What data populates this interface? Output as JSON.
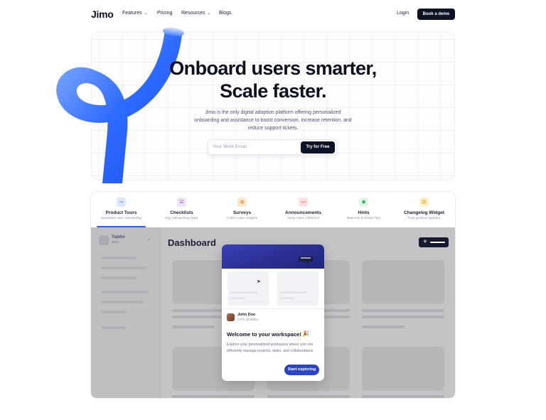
{
  "nav": {
    "logo": "Jimo",
    "links": [
      {
        "label": "Features",
        "dropdown": true
      },
      {
        "label": "Pricing",
        "dropdown": false
      },
      {
        "label": "Resources",
        "dropdown": true
      },
      {
        "label": "Blogs",
        "dropdown": false
      }
    ],
    "login": "Login",
    "cta": "Book a demo"
  },
  "hero": {
    "headline_line1": "Onboard users smarter,",
    "headline_line2": "Scale faster.",
    "subtext_line1": "Jimo is the only digital adoption platform offering personalized",
    "subtext_line2": "onboarding and assistance to boost conversion, increase retention, and",
    "subtext_line3": "reduce support tickets.",
    "email_placeholder": "Your Work Email",
    "cta": "Try for Free",
    "accent_color": "#2f6bff"
  },
  "product_tabs": [
    {
      "label": "Product Tours",
      "desc": "Seamless user onboarding",
      "icon": "route-icon",
      "icon_color": "#dce8ff",
      "active": true
    },
    {
      "label": "Checklists",
      "desc": "Key onboarding steps",
      "icon": "checklist-icon",
      "icon_color": "#f0e3ff",
      "active": false
    },
    {
      "label": "Surveys",
      "desc": "Collect user insights",
      "icon": "survey-icon",
      "icon_color": "#ffe6cf",
      "active": false
    },
    {
      "label": "Announcements",
      "desc": "Keep users informed",
      "icon": "announcement-icon",
      "icon_color": "#ffe1e1",
      "active": false
    },
    {
      "label": "Hints",
      "desc": "Beacons & Smart Tips",
      "icon": "hint-icon",
      "icon_color": "#dff5e5",
      "active": false
    },
    {
      "label": "Changelog Widget",
      "desc": "Post product updates",
      "icon": "changelog-icon",
      "icon_color": "#fff1c7",
      "active": false
    }
  ],
  "app": {
    "workspace_name": "Tablio",
    "workspace_sub": "Jimo",
    "dashboard_title": "Dashboard"
  },
  "modal": {
    "user_name": "John Doe",
    "user_role": "CPO @Tablio",
    "title": "Welcome to your workspace!",
    "emoji": "🎉",
    "body": "Explore your personalized workspace where you can efficiently manage projects, tasks, and collaborations.",
    "cta": "Start exploring"
  }
}
